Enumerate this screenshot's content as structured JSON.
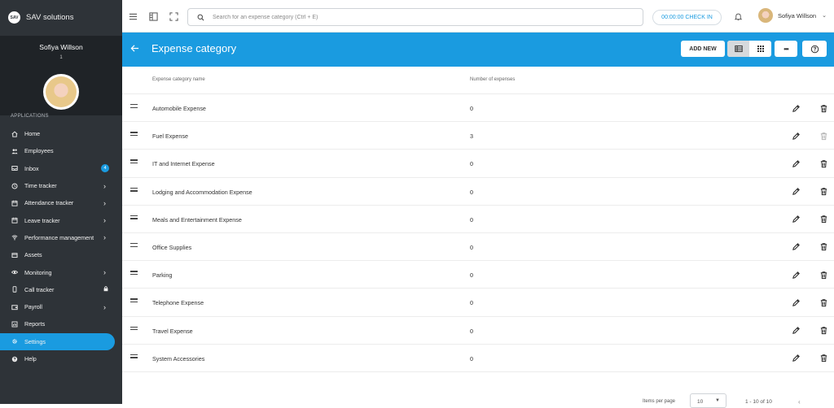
{
  "brand": {
    "logo_text": "SAV",
    "name": "SAV solutions"
  },
  "profile": {
    "name": "Sofiya Willson",
    "id": "1"
  },
  "sidebar": {
    "section_label": "APPLICATIONS",
    "items": [
      {
        "label": "Home"
      },
      {
        "label": "Employees"
      },
      {
        "label": "Inbox",
        "badge": "4"
      },
      {
        "label": "Time tracker"
      },
      {
        "label": "Attendance tracker"
      },
      {
        "label": "Leave tracker"
      },
      {
        "label": "Performance management"
      },
      {
        "label": "Assets"
      },
      {
        "label": "Monitoring"
      },
      {
        "label": "Call tracker"
      },
      {
        "label": "Payroll"
      },
      {
        "label": "Reports"
      },
      {
        "label": "Settings"
      },
      {
        "label": "Help"
      }
    ]
  },
  "topbar": {
    "search_placeholder": "Search for an expense category (Ctrl + E)",
    "checkin_label": "00:00:00 CHECK IN",
    "user_name": "Sofiya Willson"
  },
  "header": {
    "title": "Expense category",
    "add_new_label": "ADD NEW",
    "more_label": "•••"
  },
  "table": {
    "columns": [
      "Expense category name",
      "Number of expenses"
    ],
    "rows": [
      {
        "name": "Automobile Expense",
        "count": "0"
      },
      {
        "name": "Fuel Expense",
        "count": "3"
      },
      {
        "name": "IT and Internet Expense",
        "count": "0"
      },
      {
        "name": "Lodging and Accommodation Expense",
        "count": "0"
      },
      {
        "name": "Meals and Entertainment Expense",
        "count": "0"
      },
      {
        "name": "Office Supplies",
        "count": "0"
      },
      {
        "name": "Parking",
        "count": "0"
      },
      {
        "name": "Telephone Expense",
        "count": "0"
      },
      {
        "name": "Travel Expense",
        "count": "0"
      },
      {
        "name": "System Accessories",
        "count": "0"
      }
    ]
  },
  "footer": {
    "items_per_page_label": "Items per page",
    "items_per_page_value": "10",
    "range_label": "1 - 10 of 10"
  },
  "colors": {
    "accent": "#1a9be0",
    "sidebar_bg": "#2e3338",
    "profile_bg": "#1f2327"
  }
}
